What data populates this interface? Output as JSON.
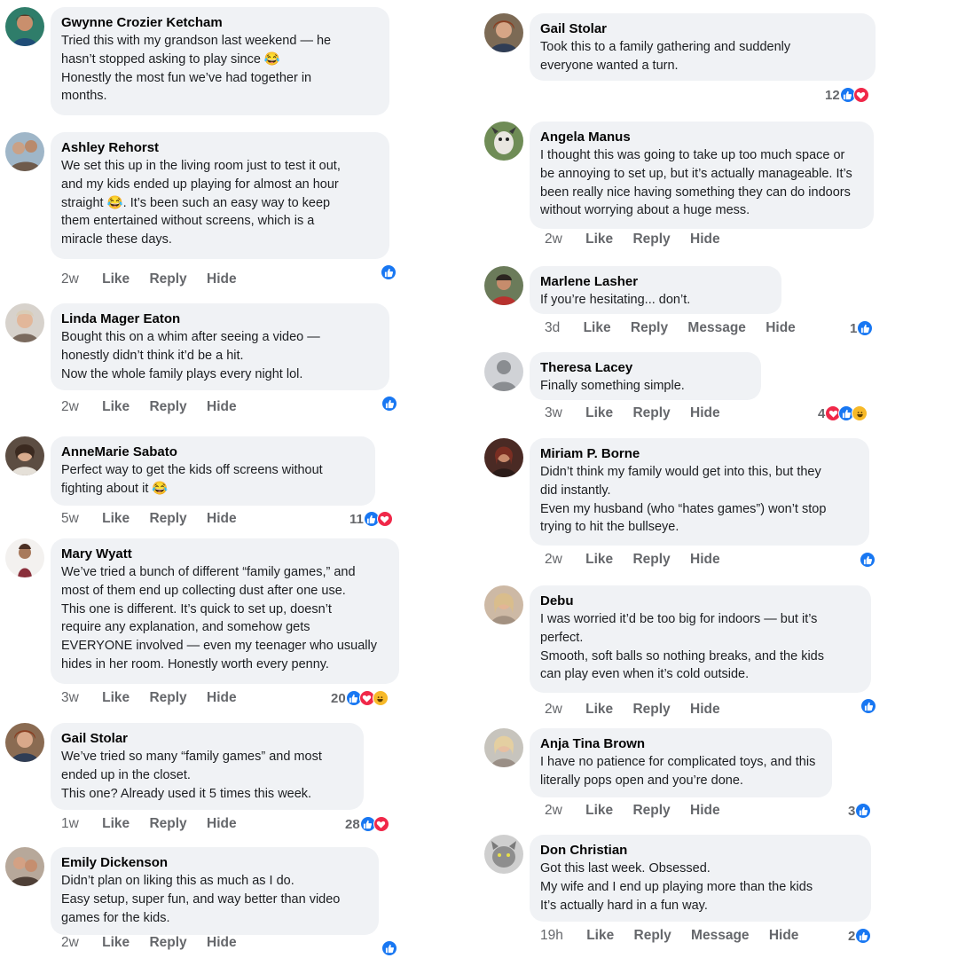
{
  "colors": {
    "bubble": "#f0f2f5",
    "meta_text": "#65676b",
    "like_blue": "#1877f2",
    "love_red": "#f02849",
    "haha_yellow": "#f7b928"
  },
  "action_labels": {
    "like": "Like",
    "reply": "Reply",
    "hide": "Hide",
    "message": "Message"
  },
  "left_comments": [
    {
      "name": "Gwynne Crozier Ketcham",
      "text": "Tried this with my grandson last weekend — he\nhasn’t stopped asking to play since 😂\nHonestly the most fun we’ve had together in\nmonths.",
      "time": "",
      "reaction_count": "",
      "reactions": []
    },
    {
      "name": "Ashley Rehorst",
      "text": "We set this up in the living room just to test it out,\nand my kids ended up playing for almost an hour\nstraight 😂. It’s been such an easy way to keep\nthem entertained without screens, which is a\nmiracle these days.",
      "time": "2w",
      "reaction_count": "",
      "reactions": [
        "like-reaction-icon"
      ]
    },
    {
      "name": "Linda Mager Eaton",
      "text": "Bought this on a whim after seeing a video —\nhonestly didn’t think it’d be a hit.\nNow the whole family plays every night lol.",
      "time": "2w",
      "reaction_count": "",
      "reactions": [
        "like-reaction-icon"
      ]
    },
    {
      "name": "AnneMarie Sabato",
      "text": "Perfect way to get the kids off screens without\nfighting about it 😂",
      "time": "5w",
      "reaction_count": "11",
      "reactions": [
        "like-reaction-icon",
        "love-reaction-icon"
      ]
    },
    {
      "name": "Mary Wyatt",
      "text": "We’ve tried a bunch of different “family games,” and\nmost of them end up collecting dust after one use.\nThis one is different. It’s quick to set up, doesn’t\nrequire any explanation, and somehow gets\nEVERYONE involved — even my teenager who usually\nhides in her room. Honestly worth every penny.",
      "time": "3w",
      "reaction_count": "20",
      "reactions": [
        "like-reaction-icon",
        "love-reaction-icon",
        "haha-reaction-icon"
      ]
    },
    {
      "name": "Gail Stolar",
      "text": "We’ve tried so many “family games” and most\nended up in the closet.\nThis one? Already used it 5 times this week.",
      "time": "1w",
      "reaction_count": "28",
      "reactions": [
        "like-reaction-icon",
        "love-reaction-icon"
      ]
    },
    {
      "name": "Emily Dickenson",
      "text": "Didn’t plan on liking this as much as I do.\nEasy setup, super fun, and way better than video\ngames for the kids.",
      "time": "2w",
      "reaction_count": "",
      "reactions": [
        "like-reaction-icon"
      ]
    }
  ],
  "right_comments": [
    {
      "name": "Gail Stolar",
      "text": "Took this to a family gathering and suddenly\neveryone wanted a turn.",
      "time": "",
      "reaction_count": "12",
      "reactions": [
        "like-reaction-icon",
        "love-reaction-icon"
      ]
    },
    {
      "name": "Angela Manus",
      "text": "I thought this was going to take up too much space or\nbe annoying to set up, but it’s actually manageable. It’s\nbeen really nice having something they can do indoors\nwithout worrying about a huge mess.",
      "time": "2w",
      "reaction_count": "",
      "reactions": []
    },
    {
      "name": "Marlene Lasher",
      "text": "If you’re hesitating... don’t.",
      "time": "3d",
      "reaction_count": "1",
      "reactions": [
        "like-reaction-icon"
      ]
    },
    {
      "name": "Theresa Lacey",
      "text": "Finally something simple.",
      "time": "3w",
      "reaction_count": "4",
      "reactions": [
        "love-reaction-icon",
        "like-reaction-icon",
        "haha-reaction-icon"
      ]
    },
    {
      "name": "Miriam P. Borne",
      "text": "Didn’t think my family would get into this, but they\ndid instantly.\nEven my husband (who “hates games”) won’t stop\ntrying to hit the bullseye.",
      "time": "2w",
      "reaction_count": "",
      "reactions": [
        "like-reaction-icon"
      ]
    },
    {
      "name": "Debu",
      "text": "I was worried it’d be too big for indoors — but it’s\nperfect.\nSmooth, soft balls so nothing breaks, and the kids\ncan play even when it’s cold outside.",
      "time": "2w",
      "reaction_count": "",
      "reactions": [
        "like-reaction-icon"
      ]
    },
    {
      "name": "Anja Tina Brown",
      "text": "I have no patience for complicated toys, and this\nliterally pops open and you’re done.",
      "time": "2w",
      "reaction_count": "3",
      "reactions": [
        "like-reaction-icon"
      ]
    },
    {
      "name": "Don Christian",
      "text": "Got this last week. Obsessed.\n My wife and I end up playing more than the kids\n It’s actually hard in a fun way.",
      "time": "19h",
      "reaction_count": "2",
      "reactions": [
        "like-reaction-icon"
      ]
    }
  ]
}
